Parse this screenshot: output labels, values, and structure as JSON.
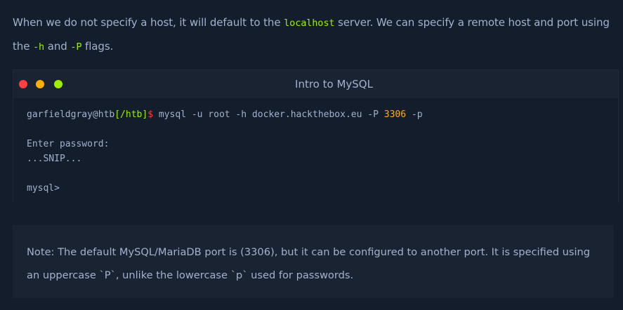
{
  "intro": {
    "text_before": "When we do not specify a host, it will default to the ",
    "code_localhost": "localhost",
    "text_middle": " server. We can specify a remote host and port using the ",
    "code_h": "-h",
    "text_and": " and ",
    "code_P": "-P",
    "text_after": " flags."
  },
  "terminal": {
    "title": "Intro to MySQL",
    "prompt_user": "garfieldgray@htb",
    "prompt_path": "[/htb]",
    "prompt_dollar": "$",
    "command_before_port": " mysql -u root -h docker.hackthebox.eu -P ",
    "port": "3306",
    "command_after_port": " -p",
    "line_password": "Enter password:",
    "line_snip": "...SNIP...",
    "line_mysql": "mysql>"
  },
  "note": {
    "text": "Note: The default MySQL/MariaDB port is (3306), but it can be configured to another port. It is specified using an uppercase `P`, unlike the lowercase `p` used for passwords."
  },
  "colors": {
    "background": "#141d2b",
    "panel": "#1a2332",
    "accent_green": "#9fef00",
    "accent_red": "#ff3e3e",
    "accent_orange": "#ffaf00"
  }
}
